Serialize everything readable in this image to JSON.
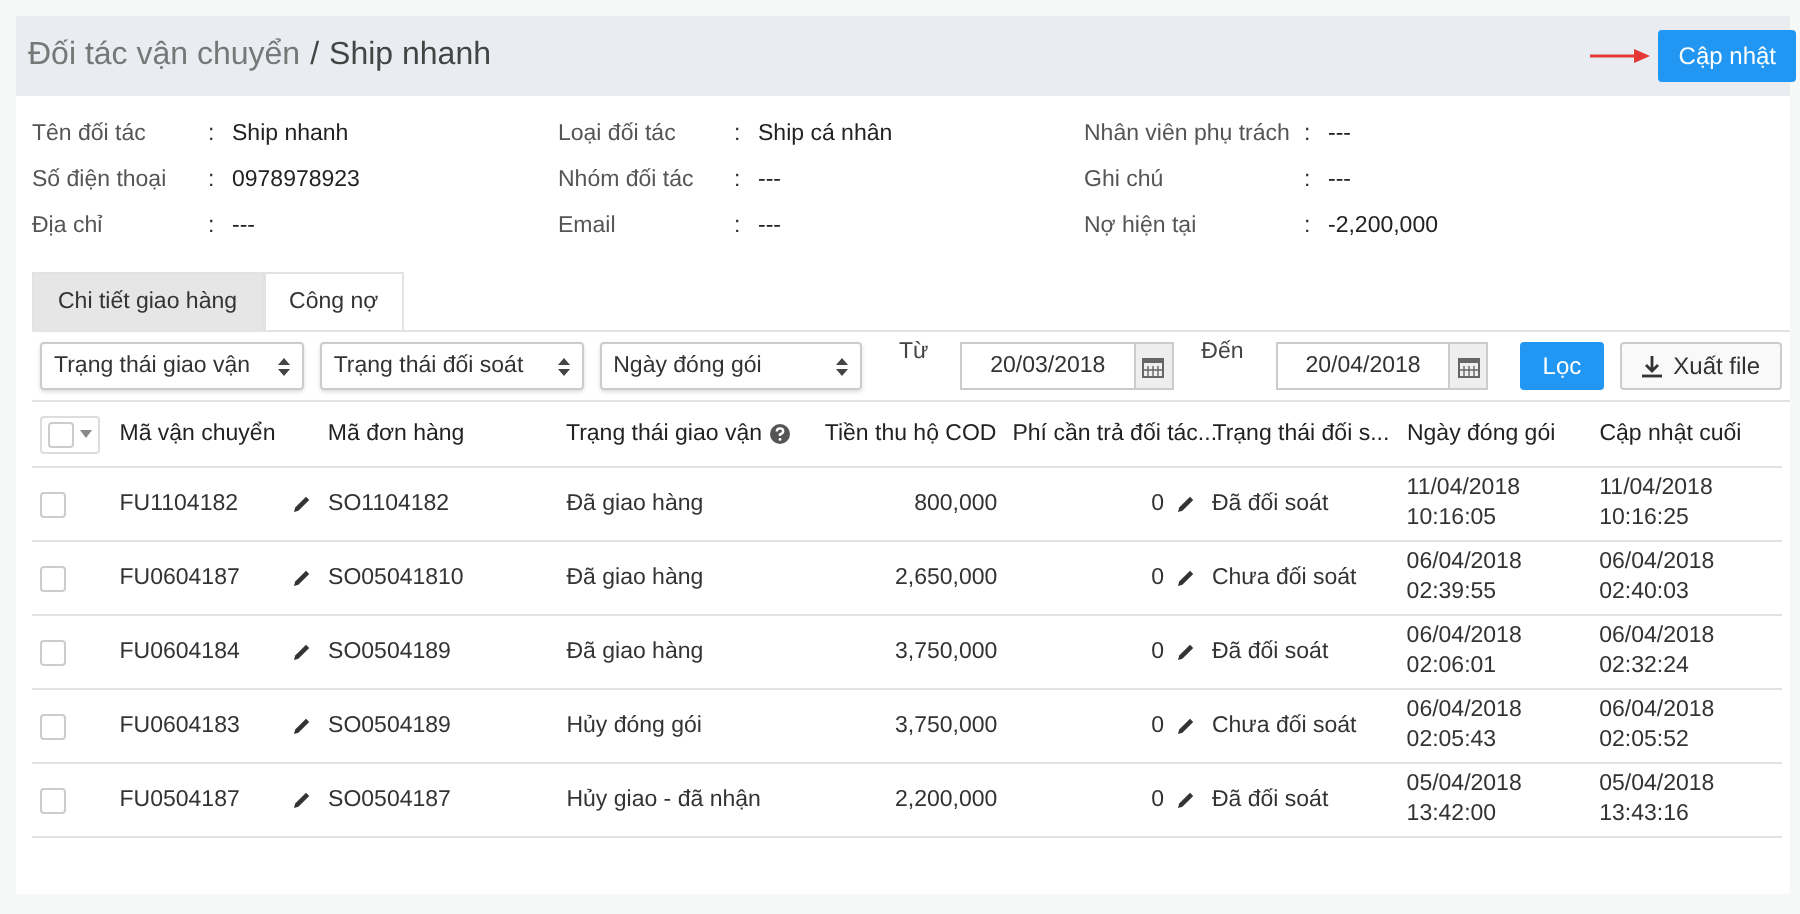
{
  "header": {
    "breadcrumb_parent": "Đối tác vận chuyển",
    "separator": "/",
    "title": "Ship nhanh",
    "update_button": "Cập nhật"
  },
  "info_separator": ":",
  "info_columns": [
    [
      {
        "label": "Tên đối tác",
        "value": "Ship nhanh"
      },
      {
        "label": "Số điện thoại",
        "value": "0978978923"
      },
      {
        "label": "Địa chỉ",
        "value": "---"
      }
    ],
    [
      {
        "label": "Loại đối tác",
        "value": "Ship cá nhân"
      },
      {
        "label": "Nhóm đối tác",
        "value": "---"
      },
      {
        "label": "Email",
        "value": "---"
      }
    ],
    [
      {
        "label": "Nhân viên phụ trách",
        "value": "---"
      },
      {
        "label": "Ghi chú",
        "value": "---"
      },
      {
        "label": "Nợ hiện tại",
        "value": "-2,200,000"
      }
    ]
  ],
  "tabs": [
    {
      "label": "Chi tiết giao hàng",
      "selected": true
    },
    {
      "label": "Công nợ",
      "selected": false
    }
  ],
  "filters": {
    "selects": [
      "Trạng thái giao vận",
      "Trạng thái đối soát",
      "Ngày đóng gói"
    ],
    "from_label": "Từ",
    "from_value": "20/03/2018",
    "to_label": "Đến",
    "to_value": "20/04/2018",
    "filter_button": "Lọc",
    "export_button": "Xuất file"
  },
  "table": {
    "select_all_checked": false,
    "columns": [
      "Mã vận chuyển",
      "Mã đơn hàng",
      "Trạng thái giao vận",
      "Tiền thu hộ COD",
      "Phí cần trả đối tác...",
      "Trạng thái đối s...",
      "Ngày đóng gói",
      "Cập nhật cuối"
    ],
    "rows": [
      {
        "checked": false,
        "shipping_code": "FU1104182",
        "order_code": "SO1104182",
        "delivery_status": "Đã giao hàng",
        "cod": "800,000",
        "fee": "0",
        "reconcile_status": "Đã đối soát",
        "packed": "11/04/2018\n10:16:05",
        "updated": "11/04/2018\n10:16:25"
      },
      {
        "checked": false,
        "shipping_code": "FU0604187",
        "order_code": "SO05041810",
        "delivery_status": "Đã giao hàng",
        "cod": "2,650,000",
        "fee": "0",
        "reconcile_status": "Chưa đối soát",
        "packed": "06/04/2018\n02:39:55",
        "updated": "06/04/2018\n02:40:03"
      },
      {
        "checked": false,
        "shipping_code": "FU0604184",
        "order_code": "SO0504189",
        "delivery_status": "Đã giao hàng",
        "cod": "3,750,000",
        "fee": "0",
        "reconcile_status": "Đã đối soát",
        "packed": "06/04/2018\n02:06:01",
        "updated": "06/04/2018\n02:32:24"
      },
      {
        "checked": false,
        "shipping_code": "FU0604183",
        "order_code": "SO0504189",
        "delivery_status": "Hủy đóng gói",
        "cod": "3,750,000",
        "fee": "0",
        "reconcile_status": "Chưa đối soát",
        "packed": "06/04/2018\n02:05:43",
        "updated": "06/04/2018\n02:05:52"
      },
      {
        "checked": false,
        "shipping_code": "FU0504187",
        "order_code": "SO0504187",
        "delivery_status": "Hủy giao - đã nhận",
        "cod": "2,200,000",
        "fee": "0",
        "reconcile_status": "Đã đối soát",
        "packed": "05/04/2018\n13:42:00",
        "updated": "05/04/2018\n13:43:16"
      }
    ]
  }
}
